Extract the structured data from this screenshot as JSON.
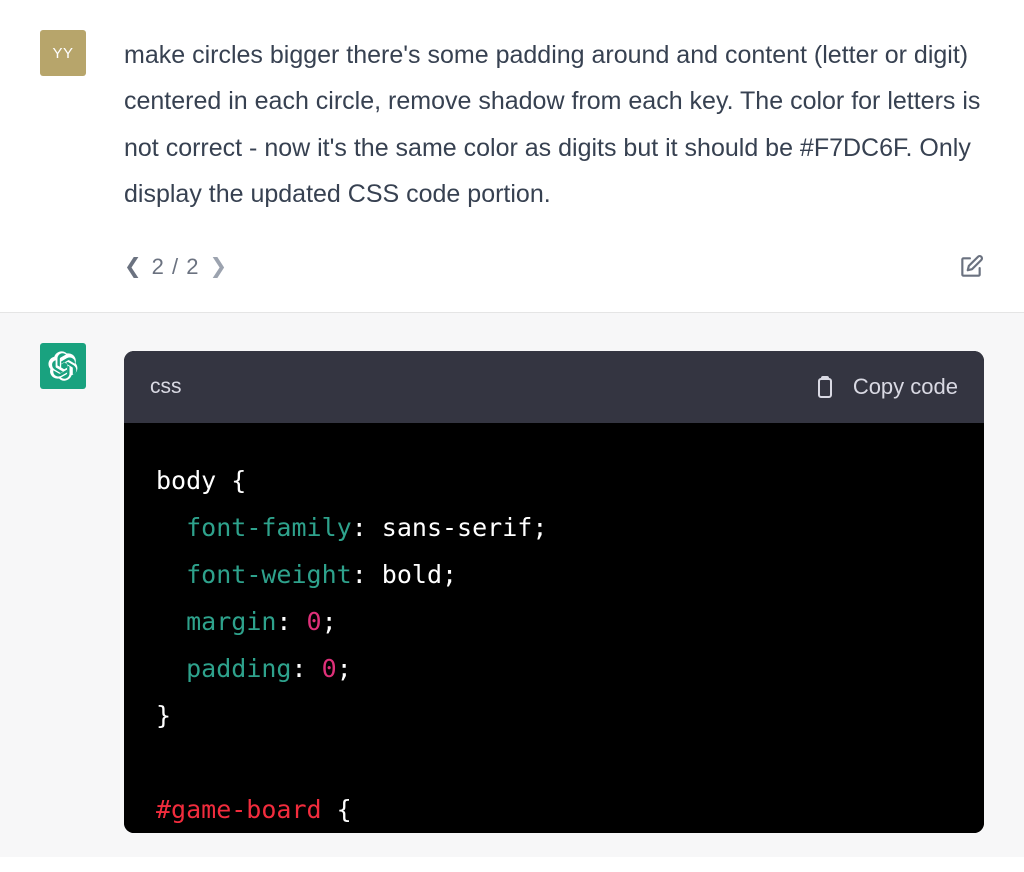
{
  "user": {
    "avatar_initials": "YY",
    "message": "make circles bigger there's some padding around and content (letter or digit) centered in each circle, remove shadow from each key. The color for letters is not correct - now it's the same color as digits but it should be #F7DC6F. Only display the updated CSS code portion.",
    "pager": {
      "current": "2",
      "sep": "/",
      "total": "2"
    }
  },
  "assistant": {
    "code_lang": "css",
    "copy_label": "Copy code",
    "code": {
      "l1_sel": "body",
      "l1_brace": " {",
      "l2_prop": "font-family",
      "l2_colon": ": ",
      "l2_val": "sans-serif",
      "semi": ";",
      "l3_prop": "font-weight",
      "l3_val": "bold",
      "l4_prop": "margin",
      "l4_num": "0",
      "l5_prop": "padding",
      "l5_num": "0",
      "l6_close": "}",
      "l8_id": "#game-board",
      "l8_brace": " {"
    }
  }
}
